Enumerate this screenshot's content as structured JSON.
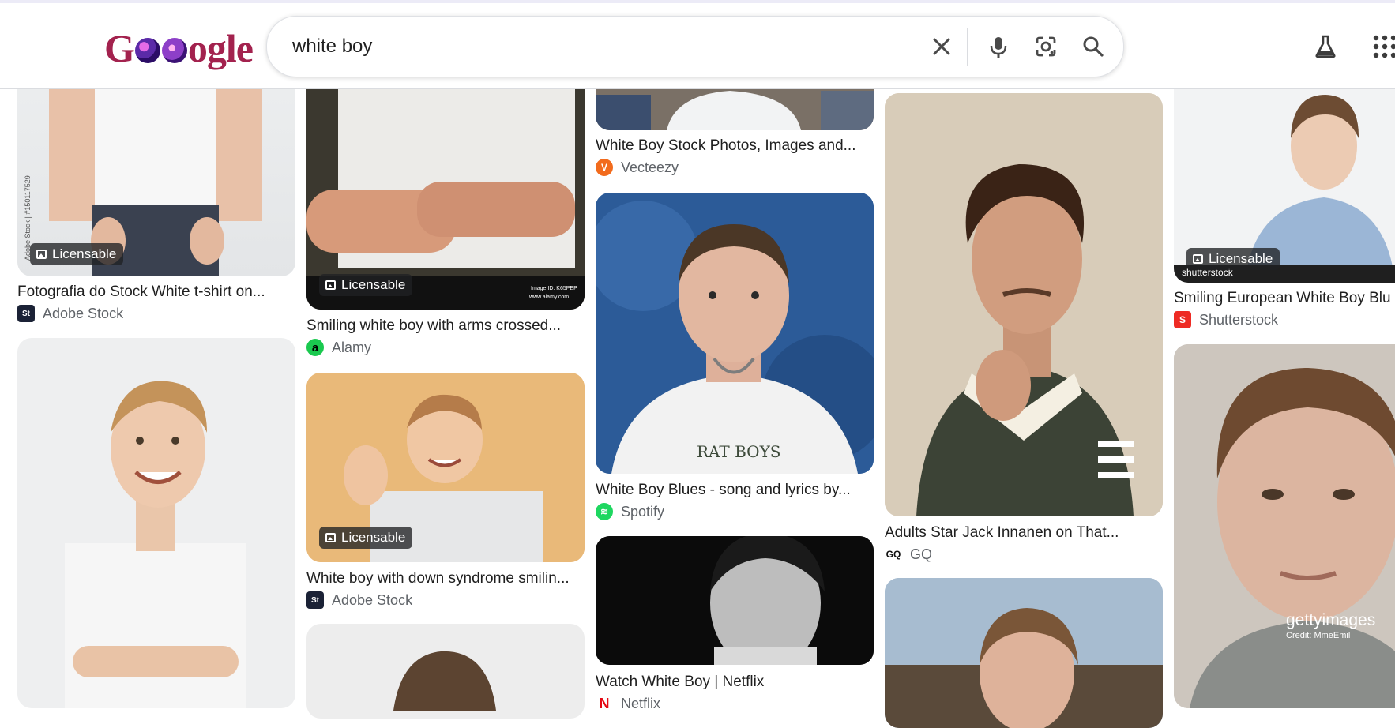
{
  "search": {
    "query": "white boy",
    "clear_icon": "close-icon",
    "mic_icon": "microphone-icon",
    "lens_icon": "camera-lens-icon",
    "search_icon": "search-icon"
  },
  "logo": {
    "text_a": "G",
    "text_b": "ogle"
  },
  "header": {
    "labs_icon": "flask-icon",
    "apps_icon": "apps-grid-icon"
  },
  "results": [
    {
      "title": "Fotografia do Stock White t-shirt on...",
      "source": "Adobe Stock",
      "badge": "Licensable",
      "fav": "St",
      "watermark": "Adobe Stock | #150117529"
    },
    {
      "title": "Smiling white boy with arms crossed...",
      "source": "Alamy",
      "badge": "Licensable",
      "fav": "a",
      "watermark": "alamy",
      "watermark2": "Image ID: K65PEP",
      "watermark3": "www.alamy.com"
    },
    {
      "title": "White Boy Stock Photos, Images and...",
      "source": "Vecteezy",
      "fav": "V"
    },
    {
      "title": "Smiling European White Boy Blu",
      "source": "Shutterstock",
      "badge": "Licensable",
      "fav": "S",
      "watermark": "shutterstock"
    },
    {
      "title": "White boy with down syndrome smilin...",
      "source": "Adobe Stock",
      "badge": "Licensable",
      "fav": "St"
    },
    {
      "title": "White Boy Blues - song and lyrics by...",
      "source": "Spotify",
      "fav": "≋",
      "shirt_text": "RAT BOYS"
    },
    {
      "title": "Adults Star Jack Innanen on That...",
      "source": "GQ",
      "fav": "GQ"
    },
    {
      "title": "Watch White Boy | Netflix",
      "source": "Netflix",
      "fav": "N"
    },
    {
      "watermark": "gettyimages",
      "watermark2": "Credit: MmeEmil"
    }
  ]
}
